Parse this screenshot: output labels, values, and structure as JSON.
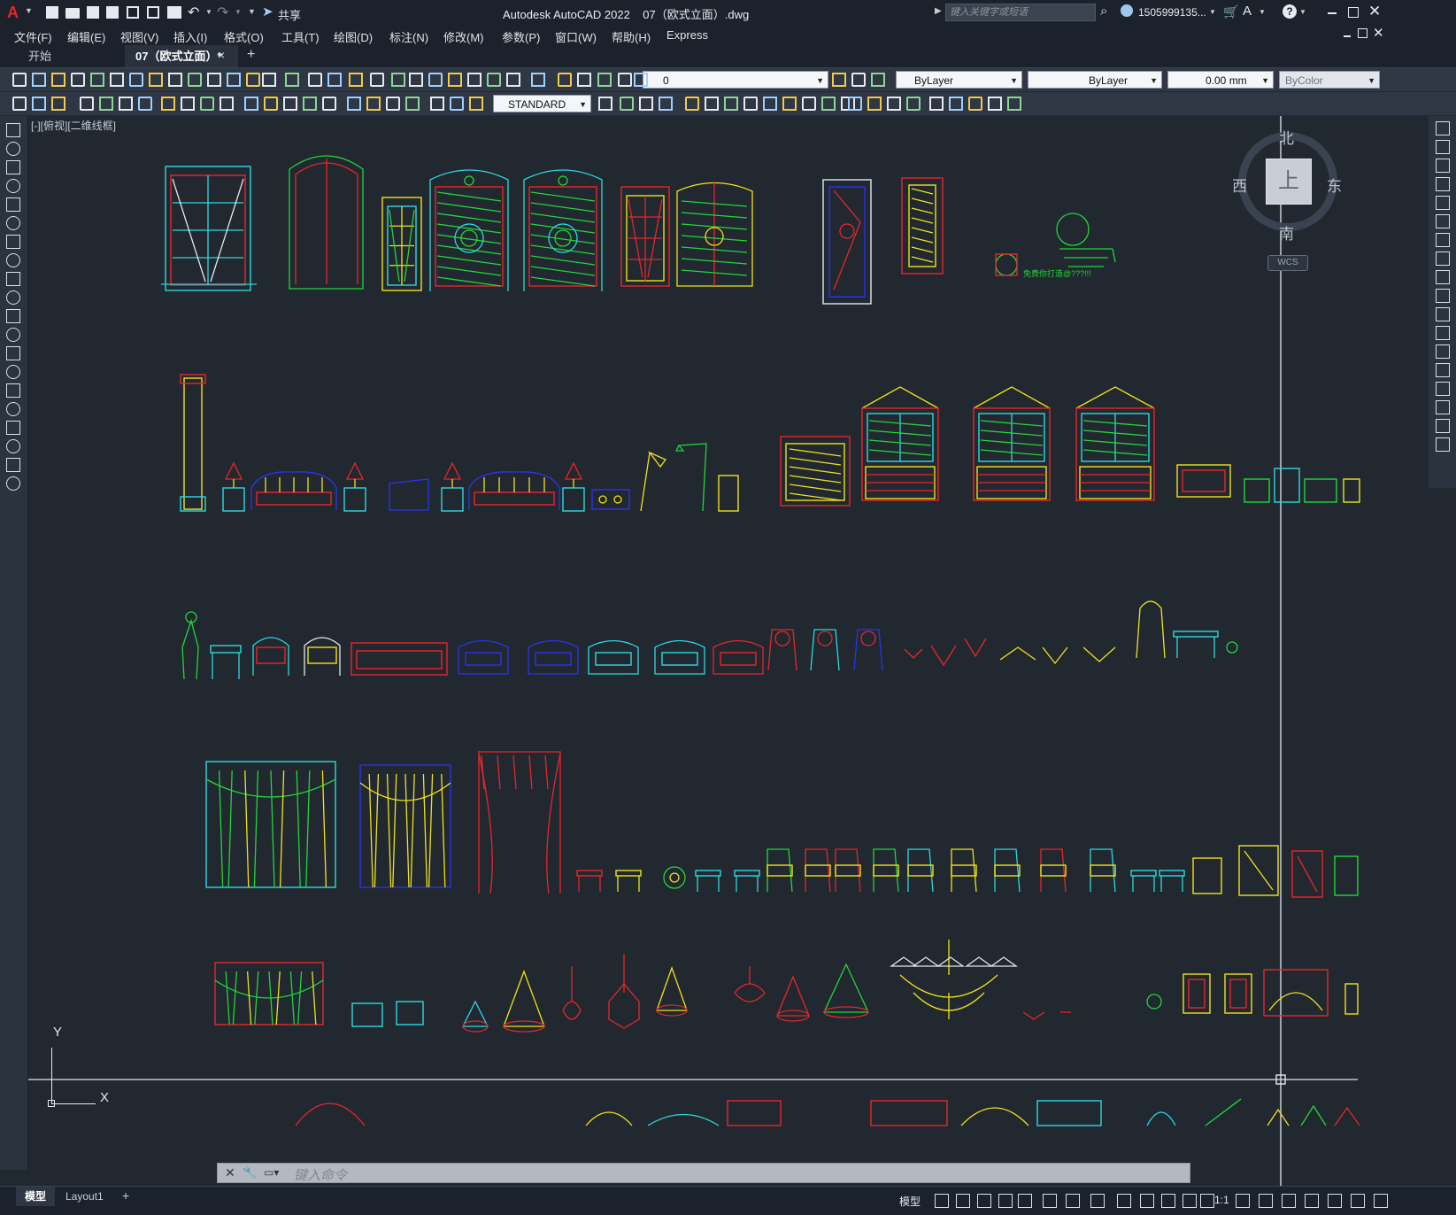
{
  "window": {
    "title": "Autodesk AutoCAD 2022    07（欧式立面）.dwg",
    "search_placeholder": "键入关键字或短语",
    "user": "1505999135...",
    "share_label": "共享"
  },
  "menu": [
    "文件(F)",
    "编辑(E)",
    "视图(V)",
    "插入(I)",
    "格式(O)",
    "工具(T)",
    "绘图(D)",
    "标注(N)",
    "修改(M)",
    "参数(P)",
    "窗口(W)",
    "帮助(H)",
    "Express"
  ],
  "tabs": {
    "start": "开始",
    "active": "07（欧式立面）*",
    "close": "×",
    "add": "+"
  },
  "toolbar": {
    "layer_value": "0",
    "color_value": "ByLayer",
    "linetype_value": "ByLayer",
    "lineweight_value": "0.00 mm",
    "plotstyle_value": "ByColor",
    "textstyle_value": "STANDARD"
  },
  "viewport": {
    "label": "[-][俯视][二维线框]",
    "viewcube": {
      "north": "北",
      "south": "南",
      "east": "东",
      "west": "西",
      "top": "上",
      "wcs": "WCS"
    },
    "ucs": {
      "x": "X",
      "y": "Y"
    },
    "drawing_note": "免费你打造@???!!!"
  },
  "command_line": {
    "placeholder": "键入命令"
  },
  "layout_tabs": {
    "model": "模型",
    "layout1": "Layout1",
    "add": "+"
  },
  "status": {
    "model": "模型",
    "scale": "1:1"
  },
  "colors": {
    "cyan": "#2fd8e0",
    "red": "#e8262a",
    "yellow": "#f0e21a",
    "green": "#22d63a",
    "blue": "#2a34e8",
    "magenta": "#e51ff0",
    "bg": "#212830"
  },
  "icons": [
    "autocad-logo-icon",
    "new-icon",
    "open-icon",
    "save-icon",
    "saveas-icon",
    "plot-icon",
    "undo-icon",
    "redo-icon",
    "share-icon",
    "search-icon",
    "user-icon",
    "cart-icon",
    "help-icon",
    "minimize-icon",
    "maximize-icon",
    "close-icon",
    "pan-icon",
    "zoom-icon",
    "line-icon",
    "polyline-icon",
    "circle-icon",
    "arc-icon",
    "rectangle-icon",
    "text-icon",
    "move-icon",
    "rotate-icon",
    "scale-icon",
    "trim-icon",
    "grid-icon",
    "snap-icon",
    "ortho-icon",
    "polar-icon",
    "osnap-icon",
    "gear-icon"
  ]
}
